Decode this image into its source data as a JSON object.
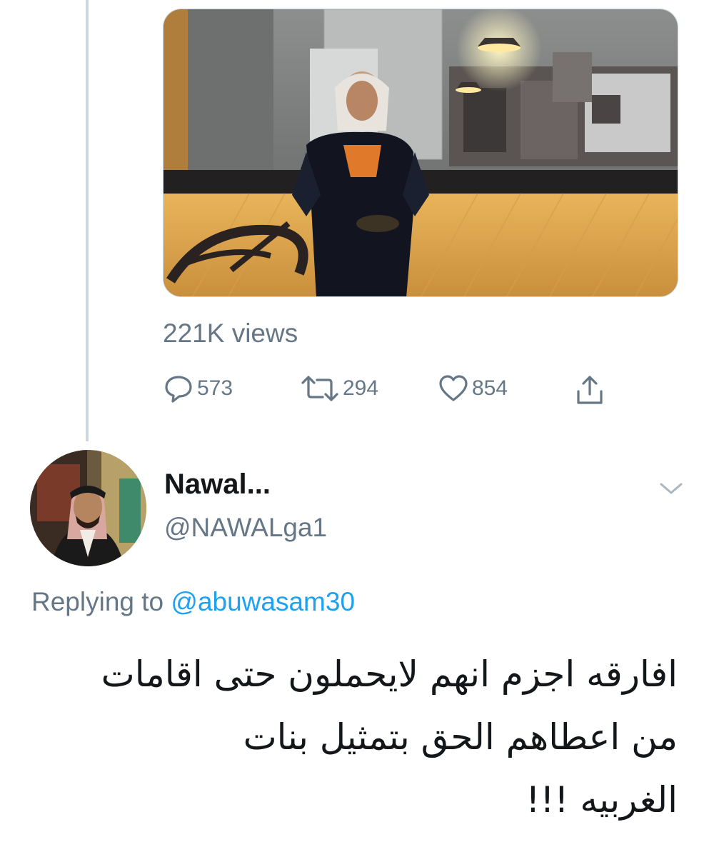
{
  "video": {
    "alt_description_visible": false
  },
  "stats": {
    "views_label": "221K views"
  },
  "actions": {
    "reply_icon": "reply-icon",
    "reply_count": "573",
    "retweet_icon": "retweet-icon",
    "retweet_count": "294",
    "like_icon": "heart-icon",
    "like_count": "854",
    "share_icon": "share-icon"
  },
  "reply_tweet": {
    "display_name": "Nawal...",
    "handle": "@NAWALga1",
    "replying_prefix": "Replying to ",
    "replying_mention": "@abuwasam30",
    "text_lines": [
      "افارقه اجزم انهم لايحملون حتى اقامات",
      "من اعطاهم الحق بتمثيل بنات",
      "الغربيه !!!"
    ]
  },
  "colors": {
    "secondary_text": "#657786",
    "link": "#1da1f2",
    "primary_text": "#14171a",
    "thread_line": "#ccd6dd"
  }
}
